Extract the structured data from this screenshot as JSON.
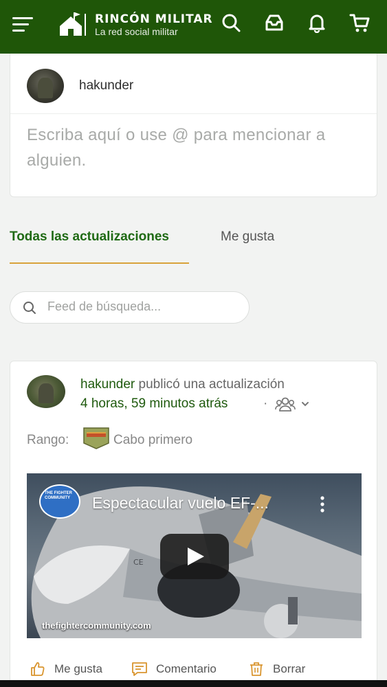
{
  "header": {
    "brand_title": "RINCÓN MILITAR",
    "brand_subtitle": "La red social militar",
    "bg_color": "#1f5608",
    "icons": [
      "menu-icon",
      "search-icon",
      "inbox-icon",
      "bell-icon",
      "cart-icon"
    ]
  },
  "composer": {
    "username": "hakunder",
    "placeholder": "Escriba aquí o use @ para mencionar a alguien."
  },
  "tabs": [
    {
      "label": "Todas las actualizaciones",
      "active": true
    },
    {
      "label": "Me gusta",
      "active": false
    }
  ],
  "search": {
    "placeholder": "Feed de búsqueda..."
  },
  "post": {
    "author": "hakunder",
    "action": "publicó una actualización",
    "time": "4 horas, 59 minutos atrás",
    "separator": "·",
    "rank_label": "Rango:",
    "rank_name": "Cabo primero",
    "video": {
      "title": "Espectacular vuelo EF-...",
      "channel": "THE FIGHTER COMMUNITY",
      "watermark": "thefightercommunity.com"
    },
    "actions": {
      "like": "Me gusta",
      "comment": "Comentario",
      "delete": "Borrar"
    }
  },
  "colors": {
    "accent_green": "#1f6a14",
    "tab_underline": "#d8a23a",
    "icon_orange": "#d9952f"
  }
}
